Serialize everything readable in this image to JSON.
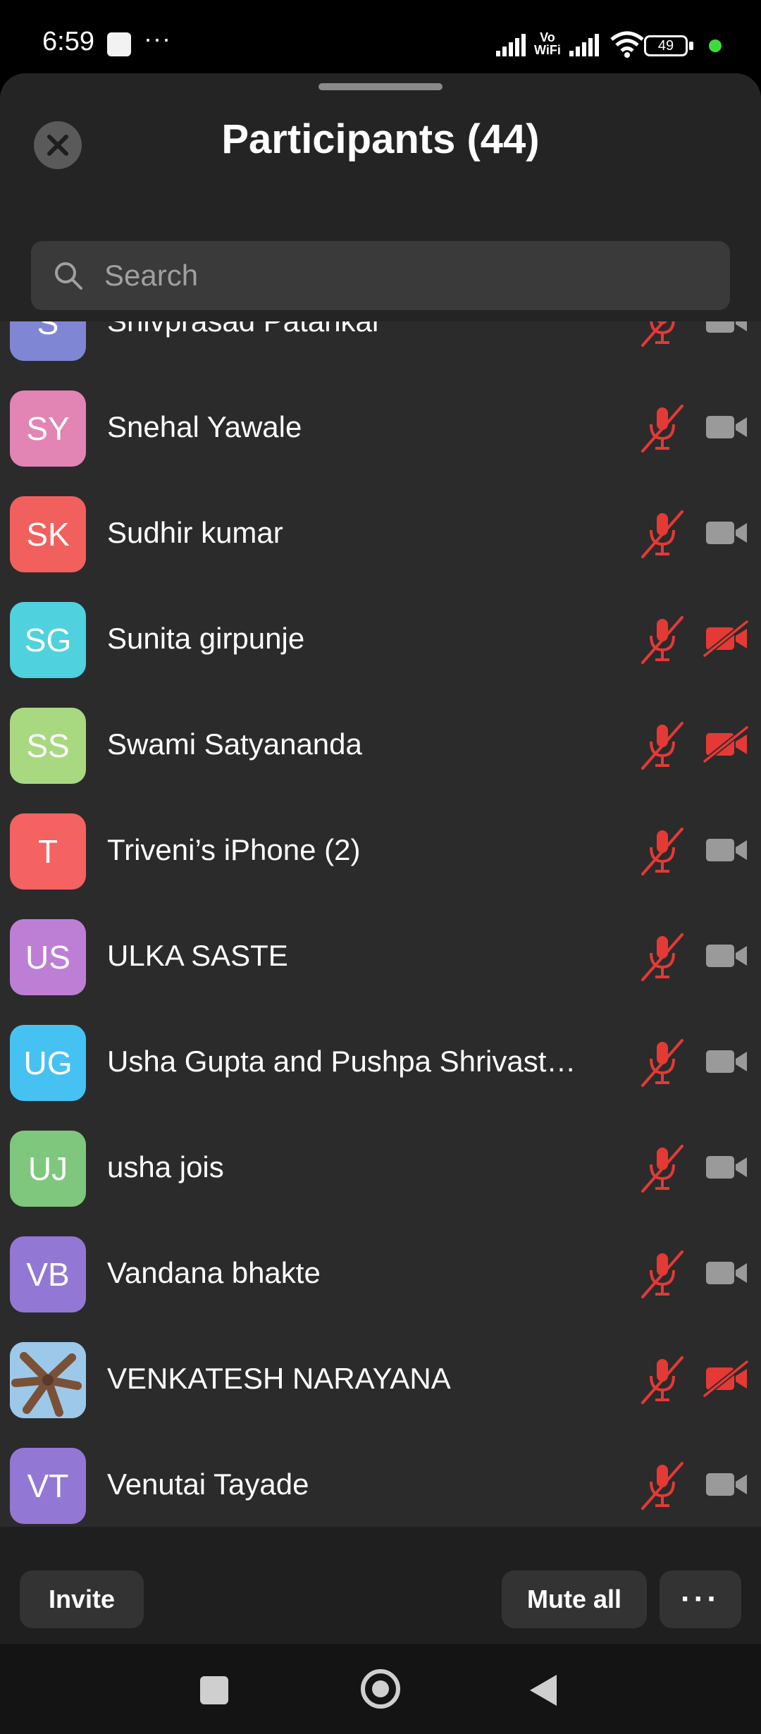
{
  "status_bar": {
    "time": "6:59",
    "more": "···",
    "volte_top": "Vo",
    "volte_bottom": "WiFi",
    "battery": "49"
  },
  "header": {
    "title": "Participants (44)",
    "close_icon": "close-icon"
  },
  "search": {
    "placeholder": "Search",
    "icon": "search-icon"
  },
  "participants": [
    {
      "initials": "S",
      "name": "Shivprasad  Patankar",
      "color": "#7f87d4",
      "mic_muted": true,
      "video_off": false
    },
    {
      "initials": "SY",
      "name": "Snehal Yawale",
      "color": "#e284b4",
      "mic_muted": true,
      "video_off": false
    },
    {
      "initials": "SK",
      "name": "Sudhir kumar",
      "color": "#f2605e",
      "mic_muted": true,
      "video_off": false
    },
    {
      "initials": "SG",
      "name": "Sunita girpunje",
      "color": "#4fd1de",
      "mic_muted": true,
      "video_off": true
    },
    {
      "initials": "SS",
      "name": "Swami Satyananda",
      "color": "#a8d880",
      "mic_muted": true,
      "video_off": true
    },
    {
      "initials": "T",
      "name": "Triveni’s iPhone (2)",
      "color": "#f56262",
      "mic_muted": true,
      "video_off": false
    },
    {
      "initials": "US",
      "name": "ULKA SASTE",
      "color": "#bd7fd6",
      "mic_muted": true,
      "video_off": false
    },
    {
      "initials": "UG",
      "name": "Usha Gupta and Pushpa Shrivast…",
      "color": "#46c2f2",
      "mic_muted": true,
      "video_off": false
    },
    {
      "initials": "UJ",
      "name": "usha jois",
      "color": "#7ec77d",
      "mic_muted": true,
      "video_off": false
    },
    {
      "initials": "VB",
      "name": "Vandana bhakte",
      "color": "#9278d4",
      "mic_muted": true,
      "video_off": false
    },
    {
      "initials": "",
      "name": "VENKATESH NARAYANA",
      "color": "#8fc0e4",
      "photo": true,
      "mic_muted": true,
      "video_off": true
    },
    {
      "initials": "VT",
      "name": "Venutai Tayade",
      "color": "#9278d4",
      "mic_muted": true,
      "video_off": false
    }
  ],
  "bottom_bar": {
    "invite_label": "Invite",
    "mute_all_label": "Mute all",
    "more_label": "···"
  },
  "colors": {
    "muted_red": "#e53935",
    "camera_gray": "#9a9a9a",
    "sheet_bg": "#2b2b2b"
  }
}
